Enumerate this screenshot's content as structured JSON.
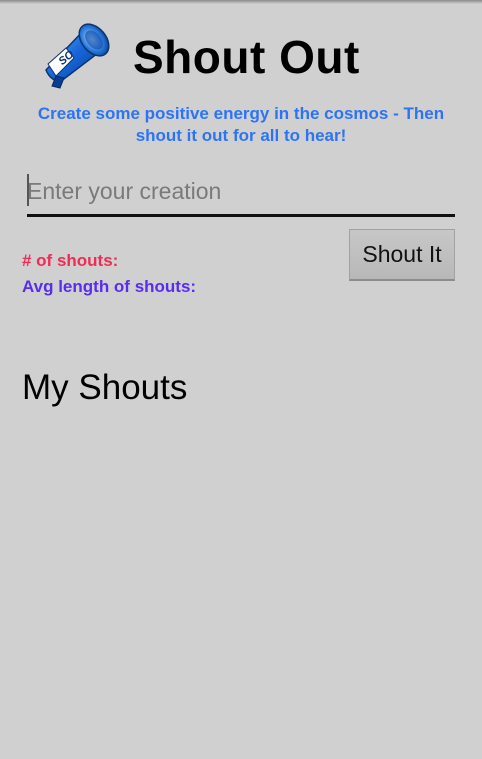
{
  "header": {
    "logo_icon": "megaphone-icon",
    "logo_badge_text": "SO",
    "title": "Shout Out",
    "tagline": "Create some positive energy in the cosmos - Then shout it out for all to hear!"
  },
  "composer": {
    "input_value": "",
    "input_placeholder": "Enter your creation",
    "submit_label": "Shout It"
  },
  "stats": {
    "count_label": "# of shouts:",
    "avg_label": "Avg length of shouts:"
  },
  "shouts": {
    "title": "My Shouts",
    "items": []
  },
  "colors": {
    "background": "#d0d0d0",
    "tagline": "#2d74f2",
    "count_label": "#ee2d55",
    "avg_label": "#5a2cf0",
    "logo_blue": "#1565d8"
  }
}
